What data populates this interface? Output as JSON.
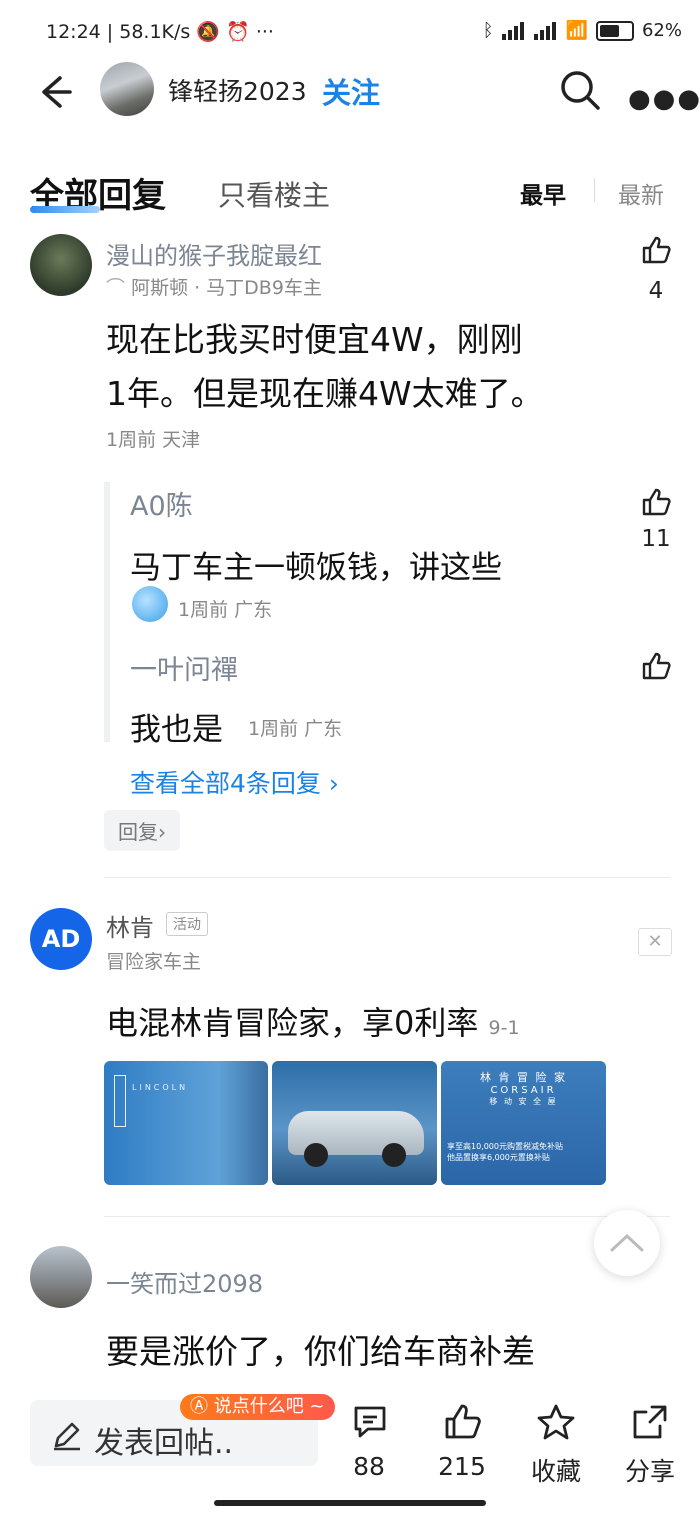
{
  "status_bar": {
    "time": "12:24",
    "net_speed": "58.1K/s",
    "battery": "62"
  },
  "header": {
    "username": "锋轻扬2023",
    "follow_label": "关注"
  },
  "tabs": {
    "all_replies": "全部回复",
    "host_only": "只看楼主",
    "sort_earliest": "最早",
    "sort_newest": "最新"
  },
  "comments": [
    {
      "username": "漫山的猴子我腚最红",
      "badge": "阿斯顿 · 马丁DB9车主",
      "likes": "4",
      "text_line1": "现在比我买时便宜4W，刚刚",
      "text_line2": "1年。但是现在赚4W太难了。",
      "meta": "1周前 天津",
      "sub_replies": [
        {
          "username": "A0陈",
          "text": "马丁车主一顿饭钱，讲这些",
          "meta": "1周前 广东",
          "likes": "11"
        },
        {
          "username": "一叶问禪",
          "text": "我也是",
          "meta": "1周前 广东"
        }
      ],
      "view_all": "查看全部4条回复 ›",
      "reply_label": "回复›"
    },
    {
      "username": "一笑而过2098",
      "text_line1": "要是涨价了，你们给车商补差"
    }
  ],
  "ad": {
    "avatar_text": "AD",
    "name": "林肯",
    "tag": "活动",
    "subtitle": "冒险家车主",
    "headline": "电混林肯冒险家，享0利率",
    "date": "9-1",
    "close": "✕",
    "img1_brand": "LINCOLN",
    "img3_title": "林 肯 冒 险 家",
    "img3_sub": "CORSAIR",
    "img3_sub2": "移 动 安 全 屋",
    "img3_offer1": "享至高10,000元购置税减免补贴",
    "img3_offer2": "他品置换享6,000元置换补贴"
  },
  "bottom": {
    "input_placeholder": "发表回帖..",
    "bubble": "说点什么吧 ~",
    "comment_count": "88",
    "like_count": "215",
    "favorite": "收藏",
    "share": "分享"
  }
}
